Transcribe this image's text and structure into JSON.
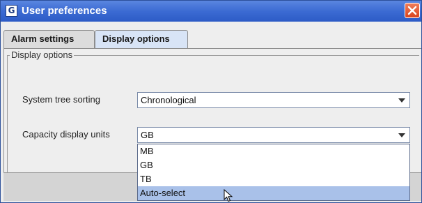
{
  "window": {
    "title": "User preferences",
    "app_icon": "app-logo-icon",
    "close_icon": "close-icon",
    "accent": "#3c6bd3"
  },
  "tabs": [
    {
      "label": "Alarm settings",
      "selected": false
    },
    {
      "label": "Display options",
      "selected": true
    }
  ],
  "group": {
    "title": "Display options"
  },
  "fields": {
    "system_tree_sorting": {
      "label": "System tree sorting",
      "value": "Chronological"
    },
    "capacity_display_units": {
      "label": "Capacity display units",
      "value": "GB",
      "options": [
        "MB",
        "GB",
        "TB",
        "Auto-select"
      ],
      "highlighted": "Auto-select",
      "expanded": true
    }
  },
  "colors": {
    "selection": "#a9c1e9",
    "active_tab": "#d8e4f6",
    "close_button": "#d9431c"
  }
}
